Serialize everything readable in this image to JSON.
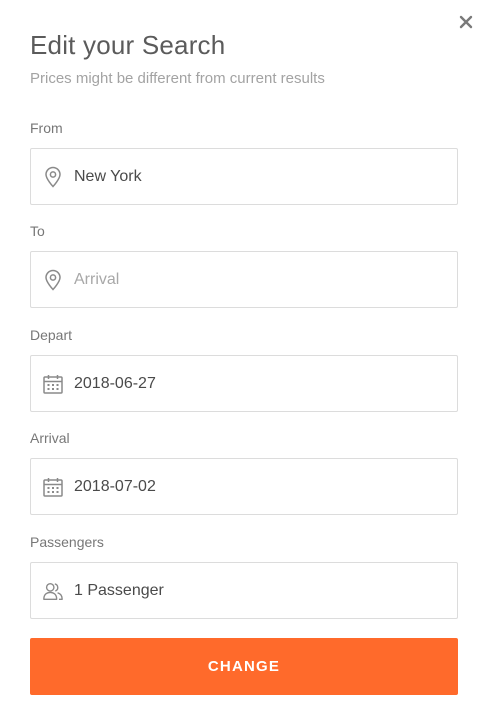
{
  "dialog": {
    "title": "Edit your Search",
    "subtitle": "Prices might be different from current results",
    "close_icon": "close-icon"
  },
  "fields": {
    "from": {
      "label": "From",
      "value": "New York",
      "placeholder": "",
      "icon": "map-pin-icon"
    },
    "to": {
      "label": "To",
      "value": "",
      "placeholder": "Arrival",
      "icon": "map-pin-icon"
    },
    "depart": {
      "label": "Depart",
      "value": "2018-06-27",
      "icon": "calendar-icon"
    },
    "arrival": {
      "label": "Arrival",
      "value": "2018-07-02",
      "icon": "calendar-icon"
    },
    "passengers": {
      "label": "Passengers",
      "value": "1 Passenger",
      "icon": "users-icon"
    }
  },
  "actions": {
    "change_label": "CHANGE"
  },
  "colors": {
    "accent": "#ff6a2b",
    "border": "#dcdcdc",
    "title": "#5b5b5b",
    "muted": "#a3a3a3"
  }
}
